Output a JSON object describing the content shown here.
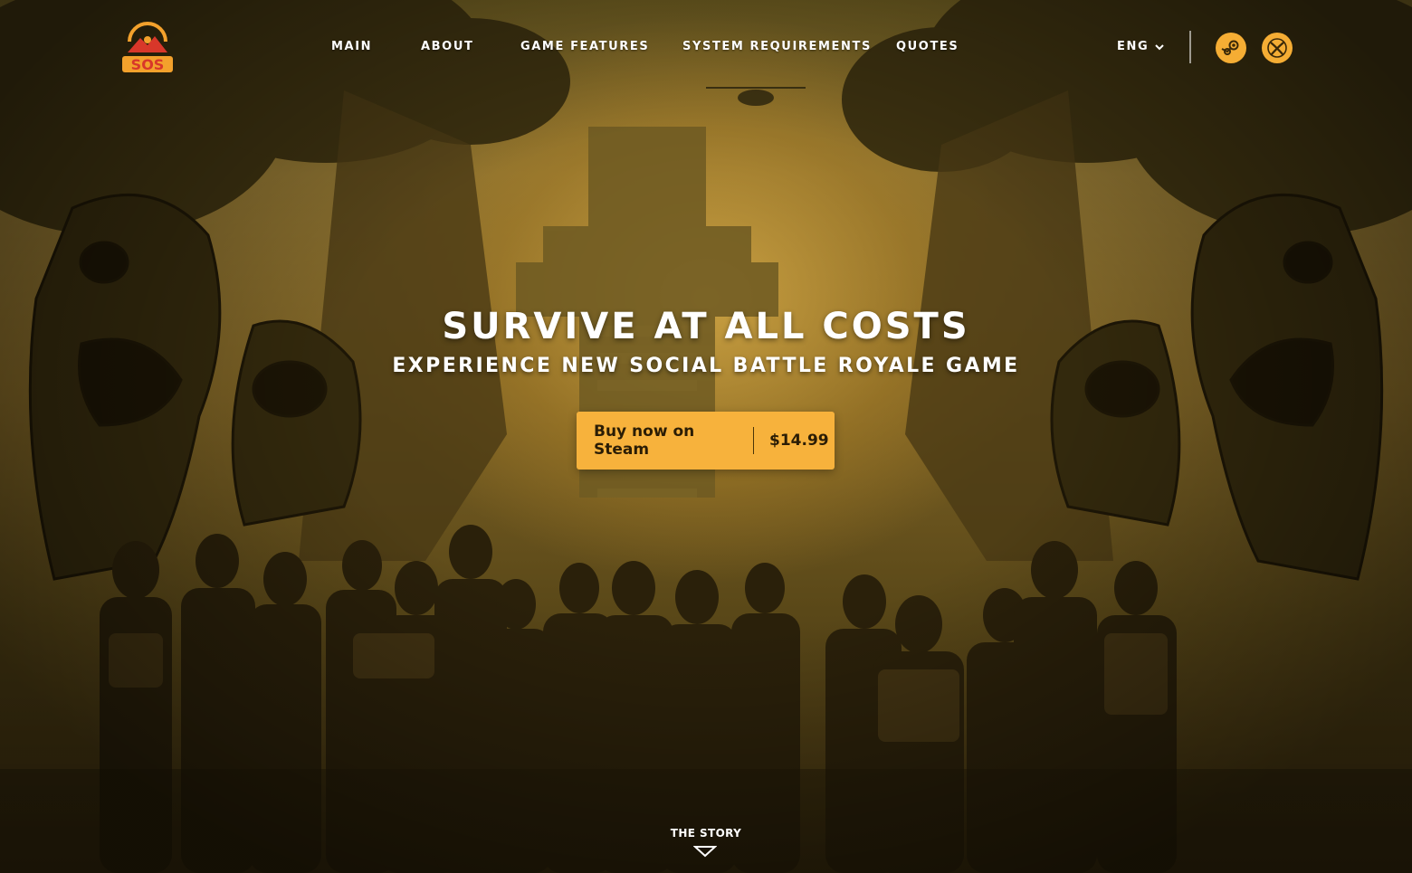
{
  "brand": {
    "logo_text": "SOS",
    "logo_icon": "mountain-sun-logo"
  },
  "nav": {
    "items": [
      {
        "label": "MAIN"
      },
      {
        "label": "ABOUT"
      },
      {
        "label": "GAME FEATURES"
      },
      {
        "label": "SYSTEM REQUIREMENTS"
      },
      {
        "label": "QUOTES"
      }
    ],
    "language": "ENG"
  },
  "platforms": [
    {
      "name": "steam",
      "icon": "steam-icon"
    },
    {
      "name": "xbox",
      "icon": "xbox-icon"
    }
  ],
  "hero": {
    "title": "SURVIVE AT ALL COSTS",
    "subtitle": "EXPERIENCE NEW SOCIAL BATTLE ROYALE GAME",
    "cta_label": "Buy now on Steam",
    "price": "$14.99",
    "scroll_label": "THE STORY"
  },
  "colors": {
    "accent": "#f7b23c",
    "text": "#ffffff",
    "logo_red": "#d8372a",
    "logo_orange": "#f3a12c"
  }
}
